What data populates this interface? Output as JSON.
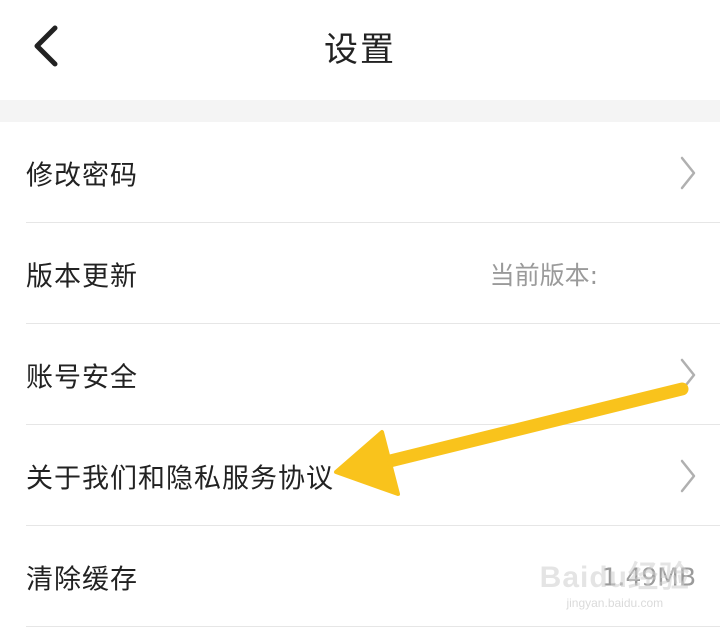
{
  "header": {
    "title": "设置",
    "back_icon": "chevron-left-icon"
  },
  "settings": {
    "items": [
      {
        "label": "修改密码",
        "value": "",
        "icon": "chevron-right-icon"
      },
      {
        "label": "版本更新",
        "value": "当前版本:",
        "icon": ""
      },
      {
        "label": "账号安全",
        "value": "",
        "icon": "chevron-right-icon"
      },
      {
        "label": "关于我们和隐私服务协议",
        "value": "",
        "icon": "chevron-right-icon"
      },
      {
        "label": "清除缓存",
        "value": "1.49MB",
        "icon": ""
      }
    ]
  },
  "annotation": {
    "arrow_color": "#f9c31c"
  },
  "watermark": {
    "logo": "Baidu经验",
    "url": "jingyan.baidu.com"
  },
  "colors": {
    "background": "#ffffff",
    "divider_band": "#f4f4f4",
    "text_primary": "#222222",
    "text_secondary": "#9a9a9a",
    "chevron": "#b0b0b0"
  }
}
